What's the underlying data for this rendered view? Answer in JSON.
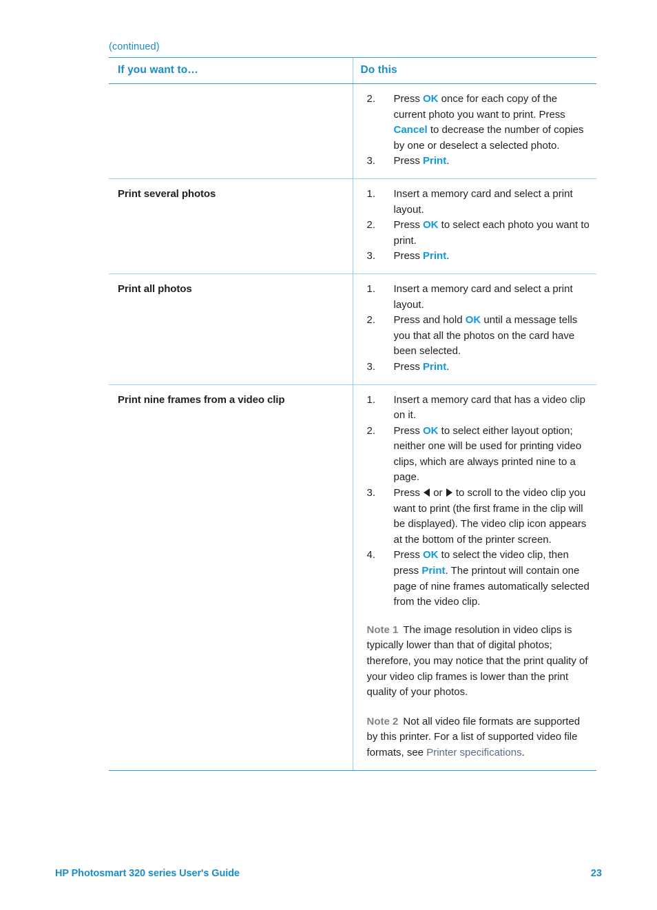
{
  "page": {
    "continued_label": "(continued)"
  },
  "table": {
    "headers": {
      "col_a": "If you want to…",
      "col_b": "Do this"
    },
    "rows": [
      {
        "title": "",
        "steps": [
          {
            "num": "2.",
            "parts": [
              {
                "t": "Press "
              },
              {
                "t": "OK",
                "style": "key"
              },
              {
                "t": " once for each copy of the current photo you want to print. Press "
              },
              {
                "t": "Cancel",
                "style": "key"
              },
              {
                "t": " to decrease the number of copies by one or deselect a selected photo."
              }
            ]
          },
          {
            "num": "3.",
            "parts": [
              {
                "t": "Press "
              },
              {
                "t": "Print",
                "style": "key"
              },
              {
                "t": "."
              }
            ]
          }
        ],
        "notes": []
      },
      {
        "title": "Print several photos",
        "steps": [
          {
            "num": "1.",
            "parts": [
              {
                "t": "Insert a memory card and select a print layout."
              }
            ]
          },
          {
            "num": "2.",
            "parts": [
              {
                "t": "Press "
              },
              {
                "t": "OK",
                "style": "key"
              },
              {
                "t": " to select each photo you want to print."
              }
            ]
          },
          {
            "num": "3.",
            "parts": [
              {
                "t": "Press "
              },
              {
                "t": "Print",
                "style": "key"
              },
              {
                "t": "."
              }
            ]
          }
        ],
        "notes": []
      },
      {
        "title": "Print all photos",
        "steps": [
          {
            "num": "1.",
            "parts": [
              {
                "t": "Insert a memory card and select a print layout."
              }
            ]
          },
          {
            "num": "2.",
            "parts": [
              {
                "t": "Press and hold "
              },
              {
                "t": "OK",
                "style": "key"
              },
              {
                "t": " until a message tells you that all the photos on the card have been selected."
              }
            ]
          },
          {
            "num": "3.",
            "parts": [
              {
                "t": "Press "
              },
              {
                "t": "Print",
                "style": "key"
              },
              {
                "t": "."
              }
            ]
          }
        ],
        "notes": []
      },
      {
        "title": "Print nine frames from a video clip",
        "steps": [
          {
            "num": "1.",
            "parts": [
              {
                "t": "Insert a memory card that has a video clip on it."
              }
            ]
          },
          {
            "num": "2.",
            "parts": [
              {
                "t": "Press "
              },
              {
                "t": "OK",
                "style": "key"
              },
              {
                "t": " to select either layout option; neither one will be used for printing video clips, which are always printed nine to a page."
              }
            ]
          },
          {
            "num": "3.",
            "parts": [
              {
                "t": "Press "
              },
              {
                "icon": "arrow-left-icon"
              },
              {
                "t": "or "
              },
              {
                "icon": "arrow-right-icon"
              },
              {
                "t": "to scroll to the video clip you want to print (the first frame in the clip will be displayed). The video clip icon appears at the bottom of the printer screen."
              }
            ]
          },
          {
            "num": "4.",
            "parts": [
              {
                "t": "Press "
              },
              {
                "t": "OK",
                "style": "key"
              },
              {
                "t": " to select the video clip, then press "
              },
              {
                "t": "Print",
                "style": "key"
              },
              {
                "t": ". The printout will contain one page of nine frames automatically selected from the video clip."
              }
            ]
          }
        ],
        "notes": [
          {
            "label": "Note 1",
            "parts": [
              {
                "t": "The image resolution in video clips is typically lower than that of digital photos; therefore, you may notice that the print quality of your video clip frames is lower than the print quality of your photos."
              }
            ]
          },
          {
            "label": "Note 2",
            "parts": [
              {
                "t": "Not all video file formats are supported by this printer. For a list of supported video file formats, see "
              },
              {
                "t": "Printer specifications",
                "style": "xref"
              },
              {
                "t": "."
              }
            ]
          }
        ]
      }
    ]
  },
  "footer": {
    "title": "HP Photosmart 320 series User's Guide",
    "page_number": "23"
  },
  "colors": {
    "accent_blue": "#1b8cc6",
    "key_blue": "#0e9ade",
    "rule_blue": "#2b9bd4",
    "rule_light": "#9ad3ea",
    "note_gray": "#808285",
    "xref_gray_blue": "#5c6b87",
    "body_text": "#231f20"
  }
}
